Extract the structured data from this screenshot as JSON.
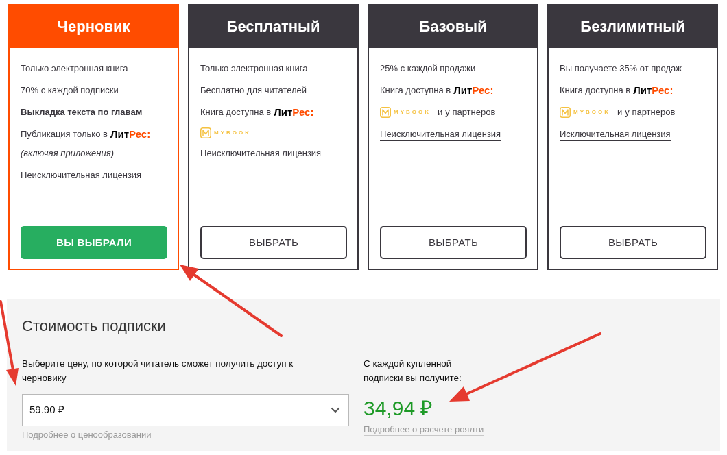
{
  "plans": [
    {
      "title": "Черновик",
      "selected": true,
      "features": [
        {
          "kind": "text",
          "text": "Только электронная книга"
        },
        {
          "kind": "text",
          "text": "70% с каждой подписки"
        },
        {
          "kind": "strong",
          "text": "Выкладка текста по главам"
        },
        {
          "kind": "store",
          "text": "Публикация только в",
          "logo": {
            "dark": "Лит",
            "accent": "Рес:"
          }
        },
        {
          "kind": "note",
          "text": "(включая приложения)"
        },
        {
          "kind": "license",
          "text": "Неисключительная лицензия"
        }
      ],
      "button": "ВЫ ВЫБРАЛИ"
    },
    {
      "title": "Бесплатный",
      "selected": false,
      "features": [
        {
          "kind": "text",
          "text": "Только электронная книга"
        },
        {
          "kind": "text",
          "text": "Бесплатно для читателей"
        },
        {
          "kind": "store",
          "text": "Книга доступна в",
          "logo": {
            "dark": "Лит",
            "accent": "Рес:"
          }
        },
        {
          "kind": "mybook",
          "wordmark": "MYBOOK"
        },
        {
          "kind": "license",
          "text": "Неисключительная лицензия"
        }
      ],
      "button": "ВЫБРАТЬ"
    },
    {
      "title": "Базовый",
      "selected": false,
      "features": [
        {
          "kind": "text",
          "text": "25% с каждой продажи"
        },
        {
          "kind": "store",
          "text": "Книга доступна в",
          "logo": {
            "dark": "Лит",
            "accent": "Рес:"
          }
        },
        {
          "kind": "partners",
          "wordmark": "MYBOOK",
          "conjunction": "и",
          "link": "у партнеров"
        },
        {
          "kind": "license",
          "text": "Неисключительная лицензия"
        }
      ],
      "button": "ВЫБРАТЬ"
    },
    {
      "title": "Безлимитный",
      "selected": false,
      "features": [
        {
          "kind": "text",
          "text": "Вы получаете 35% от продаж"
        },
        {
          "kind": "store",
          "text": "Книга доступна в",
          "logo": {
            "dark": "Лит",
            "accent": "Рес:"
          }
        },
        {
          "kind": "partners",
          "wordmark": "MYBOOK",
          "conjunction": "и",
          "link": "у партнеров"
        },
        {
          "kind": "license",
          "text": "Исключительная лицензия"
        }
      ],
      "button": "ВЫБРАТЬ"
    }
  ],
  "pricing": {
    "title": "Стоимость подписки",
    "price_label": "Выберите цену, по которой читатель сможет получить доступ к черновику",
    "price_select": {
      "value": "59.90 ₽"
    },
    "pricing_link": "Подробнее о ценообразовании",
    "royalty_label": "С каждой купленной подписки вы получите:",
    "royalty_amount": "34,94 ₽",
    "royalty_link": "Подробнее о расчете роялти"
  }
}
